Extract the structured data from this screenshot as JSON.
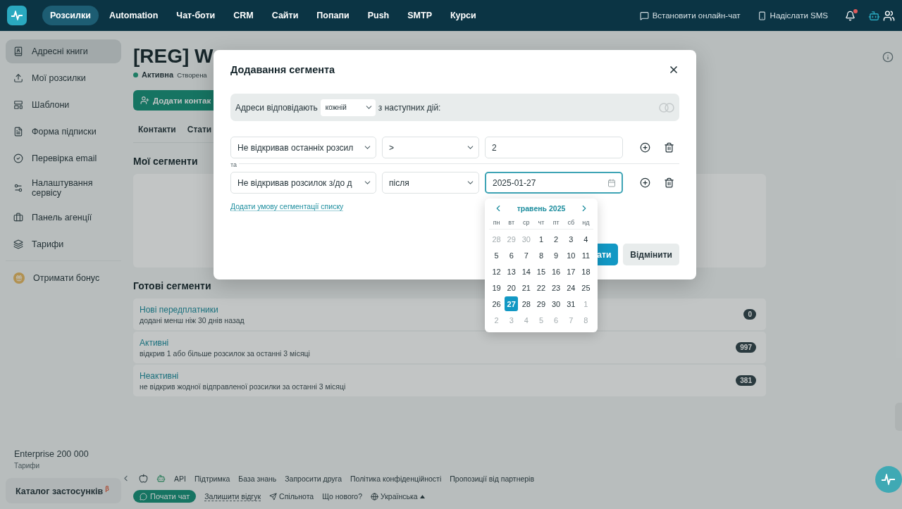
{
  "topnav": {
    "items": [
      {
        "label": "Розсилки",
        "selected": true
      },
      {
        "label": "Automation",
        "selected": false
      },
      {
        "label": "Чат-боти",
        "selected": false
      },
      {
        "label": "CRM",
        "selected": false
      },
      {
        "label": "Сайти",
        "selected": false
      },
      {
        "label": "Попапи",
        "selected": false
      },
      {
        "label": "Push",
        "selected": false
      },
      {
        "label": "SMTP",
        "selected": false
      },
      {
        "label": "Курси",
        "selected": false
      }
    ],
    "actions": [
      {
        "kind": "chat",
        "label": "Встановити онлайн-чат"
      },
      {
        "kind": "sms",
        "label": "Надіслати SMS"
      }
    ],
    "notifications_unread": true
  },
  "sidebar": {
    "items": [
      {
        "label": "Адресні книги",
        "selected": true
      },
      {
        "label": "Мої розсилки",
        "selected": false
      },
      {
        "label": "Шаблони",
        "selected": false
      },
      {
        "label": "Форма підписки",
        "selected": false
      },
      {
        "label": "Перевірка email",
        "selected": false
      },
      {
        "label": "Налаштування сервісу",
        "selected": false
      },
      {
        "label": "Панель агенції",
        "selected": false
      },
      {
        "label": "Тарифи",
        "selected": false
      }
    ],
    "bonus": "Отримати бонус",
    "plan": {
      "name": "Enterprise 200 000",
      "link": "Тарифи"
    },
    "catalog": {
      "label": "Каталог застосунків",
      "badge": "β"
    }
  },
  "page": {
    "title": "[REG] W",
    "status": "Активна",
    "created": "Створена",
    "add_button": "Додати контак",
    "tabs": [
      {
        "label": "Контакти",
        "selected": false
      },
      {
        "label": "Стати",
        "selected": false
      }
    ],
    "my_segments_title": "Мої сегменти",
    "ready_segments_title": "Готові сегменти",
    "ready_segments": [
      {
        "name": "Нові передплатники",
        "description": "додані менш ніж 30 днів назад",
        "count": "0"
      },
      {
        "name": "Активні",
        "description": "відкрив 1 або більше розсилок за останні 3 місяці",
        "count": "997"
      },
      {
        "name": "Неактивні",
        "description": "не відкрив жодної відправленої розсилки за останні 3 місяці",
        "count": "381"
      }
    ]
  },
  "footer": {
    "links": [
      "API",
      "Підтримка",
      "База знань",
      "Запросити друга",
      "Політика конфіденційності",
      "Пропозиції від партнерів"
    ],
    "chat_button": "Почати чат",
    "feedback": "Залишити відгук",
    "community": "Спільнота",
    "whats_new": "Що нового?",
    "language": "Українська"
  },
  "modal": {
    "title": "Додавання сегмента",
    "match": {
      "prefix": "Адреси відповідають",
      "mode": "кожній",
      "suffix": "з наступних дій:"
    },
    "conditions": [
      {
        "field": "Не відкривав останніх розсил",
        "operator": ">",
        "value": "2",
        "kind": "text",
        "focused": false
      },
      {
        "joiner": "та",
        "field": "Не відкривав розсилок з/до д",
        "operator": "після",
        "value": "2025-01-27",
        "kind": "date",
        "focused": true
      }
    ],
    "add_condition": "Додати умову сегментації списку",
    "buttons": [
      {
        "label": "ати",
        "kind": "primary"
      },
      {
        "label": "Відмінити",
        "kind": "secondary"
      }
    ]
  },
  "datepicker": {
    "month": "травень 2025",
    "weekdays": [
      "пн",
      "вт",
      "ср",
      "чт",
      "пт",
      "сб",
      "нд"
    ],
    "weeks": [
      [
        {
          "d": "28",
          "muted": true,
          "selected": false
        },
        {
          "d": "29",
          "muted": true,
          "selected": false
        },
        {
          "d": "30",
          "muted": true,
          "selected": false
        },
        {
          "d": "1",
          "muted": false,
          "selected": false
        },
        {
          "d": "2",
          "muted": false,
          "selected": false
        },
        {
          "d": "3",
          "muted": false,
          "selected": false
        },
        {
          "d": "4",
          "muted": false,
          "selected": false
        }
      ],
      [
        {
          "d": "5",
          "muted": false,
          "selected": false
        },
        {
          "d": "6",
          "muted": false,
          "selected": false
        },
        {
          "d": "7",
          "muted": false,
          "selected": false
        },
        {
          "d": "8",
          "muted": false,
          "selected": false
        },
        {
          "d": "9",
          "muted": false,
          "selected": false
        },
        {
          "d": "10",
          "muted": false,
          "selected": false
        },
        {
          "d": "11",
          "muted": false,
          "selected": false
        }
      ],
      [
        {
          "d": "12",
          "muted": false,
          "selected": false
        },
        {
          "d": "13",
          "muted": false,
          "selected": false
        },
        {
          "d": "14",
          "muted": false,
          "selected": false
        },
        {
          "d": "15",
          "muted": false,
          "selected": false
        },
        {
          "d": "16",
          "muted": false,
          "selected": false
        },
        {
          "d": "17",
          "muted": false,
          "selected": false
        },
        {
          "d": "18",
          "muted": false,
          "selected": false
        }
      ],
      [
        {
          "d": "19",
          "muted": false,
          "selected": false
        },
        {
          "d": "20",
          "muted": false,
          "selected": false
        },
        {
          "d": "21",
          "muted": false,
          "selected": false
        },
        {
          "d": "22",
          "muted": false,
          "selected": false
        },
        {
          "d": "23",
          "muted": false,
          "selected": false
        },
        {
          "d": "24",
          "muted": false,
          "selected": false
        },
        {
          "d": "25",
          "muted": false,
          "selected": false
        }
      ],
      [
        {
          "d": "26",
          "muted": false,
          "selected": false
        },
        {
          "d": "27",
          "muted": false,
          "selected": true
        },
        {
          "d": "28",
          "muted": false,
          "selected": false
        },
        {
          "d": "29",
          "muted": false,
          "selected": false
        },
        {
          "d": "30",
          "muted": false,
          "selected": false
        },
        {
          "d": "31",
          "muted": false,
          "selected": false
        },
        {
          "d": "1",
          "muted": true,
          "selected": false
        }
      ],
      [
        {
          "d": "2",
          "muted": true,
          "selected": false
        },
        {
          "d": "3",
          "muted": true,
          "selected": false
        },
        {
          "d": "4",
          "muted": true,
          "selected": false
        },
        {
          "d": "5",
          "muted": true,
          "selected": false
        },
        {
          "d": "6",
          "muted": true,
          "selected": false
        },
        {
          "d": "7",
          "muted": true,
          "selected": false
        },
        {
          "d": "8",
          "muted": true,
          "selected": false
        }
      ]
    ]
  }
}
